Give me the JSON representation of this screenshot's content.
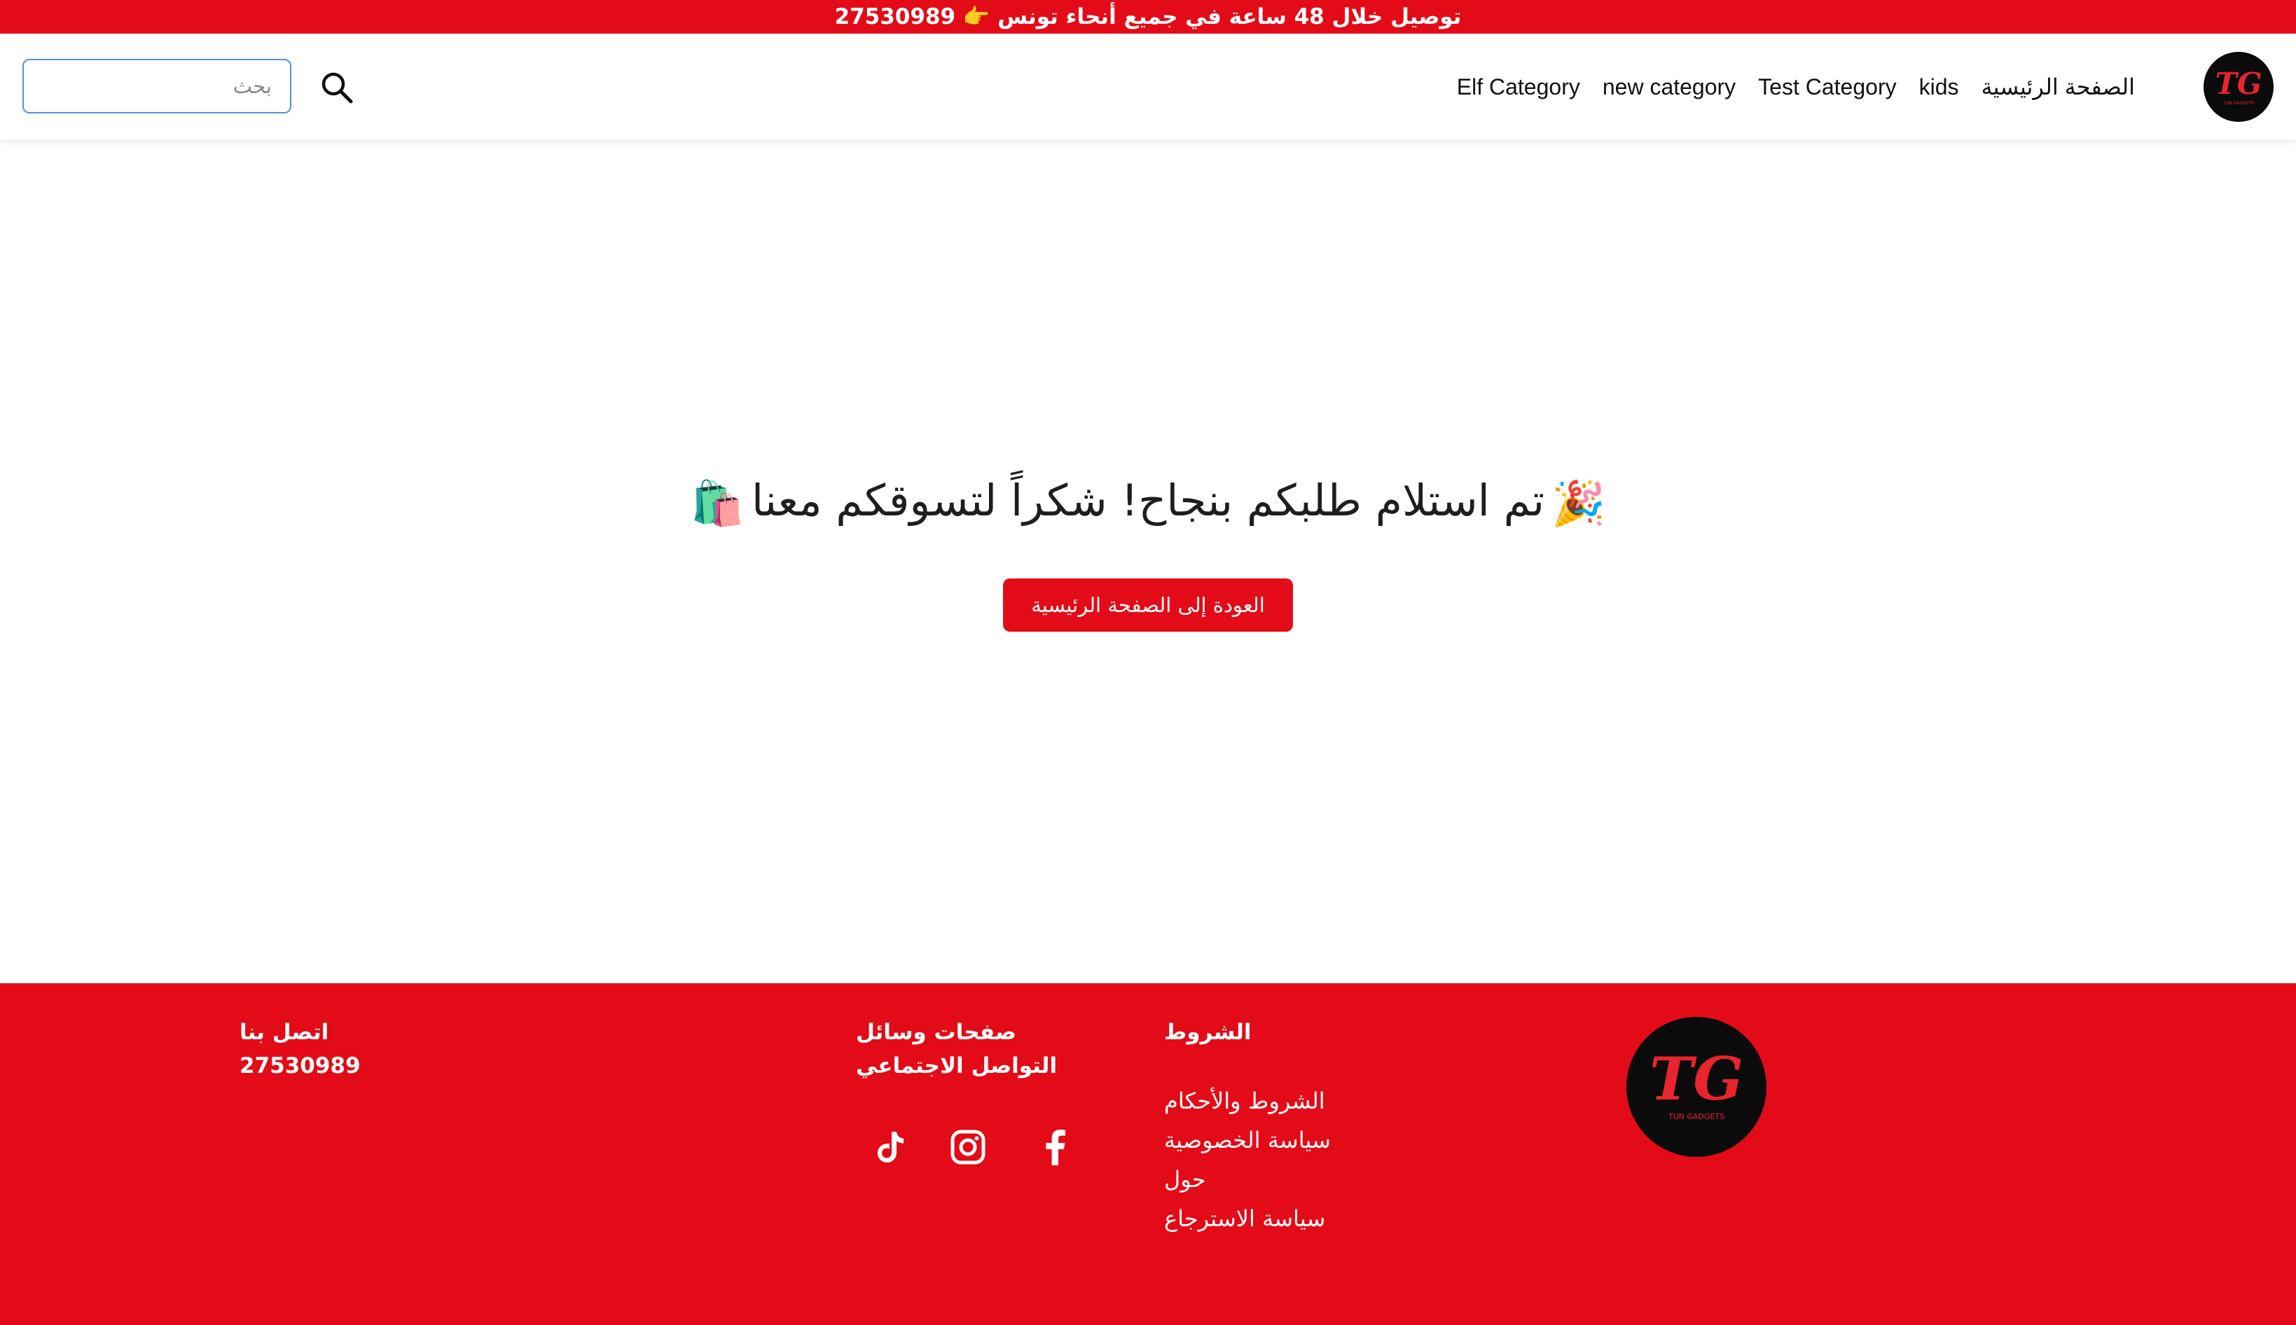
{
  "topbar": {
    "announcement": "توصيل خلال 48 ساعة في جميع أنحاء تونس 👉 27530989"
  },
  "header": {
    "search": {
      "placeholder": "بحث",
      "icon": "search-icon"
    },
    "nav": [
      {
        "label": "الصفحة الرئيسية"
      },
      {
        "label": "kids"
      },
      {
        "label": "Test Category"
      },
      {
        "label": "new category"
      },
      {
        "label": "Elf Category"
      }
    ],
    "logo": {
      "letters": "TG",
      "subtitle": "TUN GADGETS"
    }
  },
  "main": {
    "message": "تم استلام طلبكم بنجاح! شكراً لتسوقكم معنا",
    "emoji_start": "🎉",
    "emoji_end": "🛍️",
    "back_button": "العودة إلى الصفحة الرئيسية"
  },
  "footer": {
    "logo": {
      "letters": "TG",
      "subtitle": "TUN GADGETS"
    },
    "terms": {
      "title": "الشروط",
      "links": [
        {
          "label": "الشروط والأحكام"
        },
        {
          "label": "سياسة الخصوصية"
        },
        {
          "label": "حول"
        },
        {
          "label": "سياسة الاسترجاع"
        }
      ]
    },
    "social": {
      "title": "صفحات وسائل التواصل الاجتماعي",
      "icons": [
        "facebook-icon",
        "instagram-icon",
        "tiktok-icon"
      ]
    },
    "contact": {
      "title": "اتصل بنا",
      "phone": "27530989"
    }
  },
  "colors": {
    "brand_red": "#e30b17",
    "logo_black": "#0b0b0b",
    "search_border": "#5b8fd6"
  }
}
